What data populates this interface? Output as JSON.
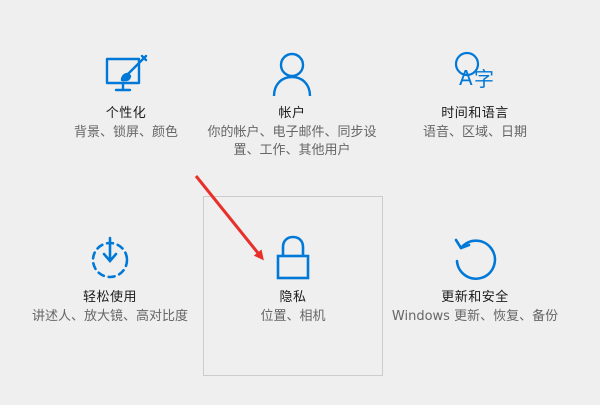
{
  "colors": {
    "accent": "#0078d7",
    "background": "#efefef",
    "title_text": "#1a1a1a",
    "desc_text": "#666666",
    "hover_border": "#cccccc",
    "annotation_arrow": "#e8302a"
  },
  "tiles": [
    {
      "id": "personalization",
      "icon": "paint-display-icon",
      "title": "个性化",
      "desc": "背景、锁屏、颜色"
    },
    {
      "id": "accounts",
      "icon": "person-icon",
      "title": "帐户",
      "desc": "你的帐户、电子邮件、同步设置、工作、其他用户"
    },
    {
      "id": "time-language",
      "icon": "language-icon",
      "title": "时间和语言",
      "desc": "语音、区域、日期"
    },
    {
      "id": "ease-of-access",
      "icon": "timer-icon",
      "title": "轻松使用",
      "desc": "讲述人、放大镜、高对比度"
    },
    {
      "id": "privacy",
      "icon": "lock-icon",
      "title": "隐私",
      "desc": "位置、相机"
    },
    {
      "id": "update-security",
      "icon": "refresh-icon",
      "title": "更新和安全",
      "desc": "Windows 更新、恢复、备份"
    }
  ]
}
